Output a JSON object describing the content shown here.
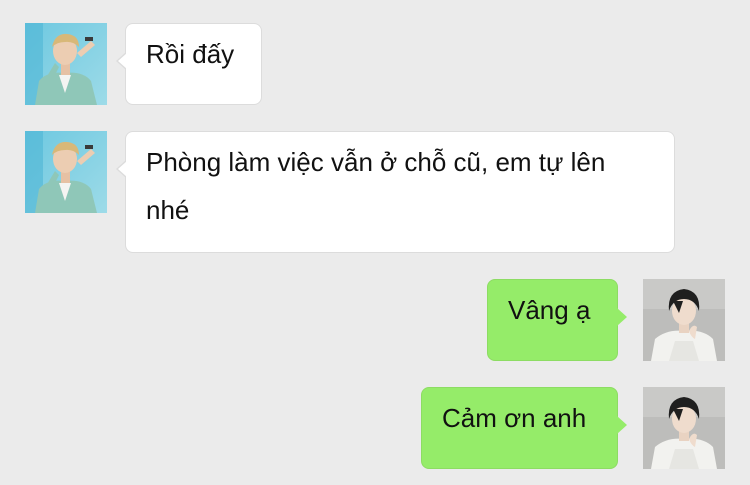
{
  "chat": {
    "messages": [
      {
        "sender": "other",
        "text": "Rồi đấy"
      },
      {
        "sender": "other",
        "text": "Phòng làm việc vẫn ở chỗ cũ, em tự lên nhé"
      },
      {
        "sender": "self",
        "text": "Vâng ạ"
      },
      {
        "sender": "self",
        "text": "Cảm ơn anh"
      }
    ]
  },
  "colors": {
    "background": "#ebebeb",
    "incoming_bubble": "#ffffff",
    "outgoing_bubble": "#95ec69"
  },
  "icons": {
    "incoming_avatar": "avatar-man-in-mint-suit",
    "outgoing_avatar": "avatar-man-in-white-shirt"
  }
}
